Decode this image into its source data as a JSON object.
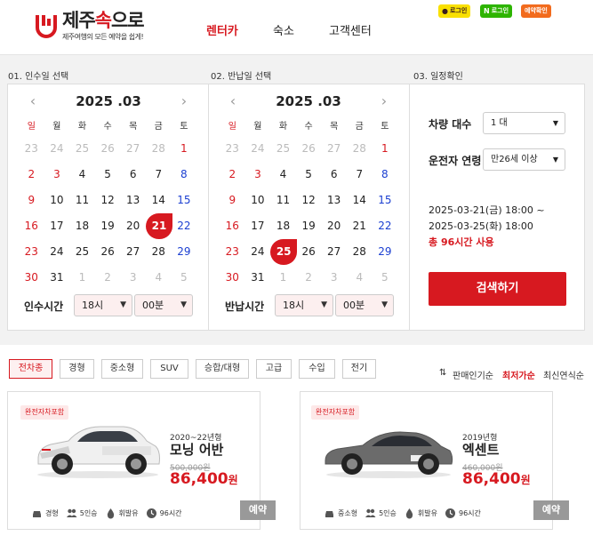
{
  "header": {
    "logo_title_a": "제주",
    "logo_title_b": "속",
    "logo_title_c": "으로",
    "logo_tagline": "제주여행의 모든 예약을 쉽게!",
    "nav": [
      "렌터카",
      "숙소",
      "고객센터"
    ],
    "kakao_login": "로그인",
    "naver_login": "로그인",
    "reserve_check": "예약확인"
  },
  "sections": {
    "pickup_label": "01. 인수일 선택",
    "return_label": "02. 반납일 선택",
    "confirm_label": "03. 일정확인"
  },
  "calendar": {
    "month_label": "2025 .03",
    "weekdays": [
      "일",
      "월",
      "화",
      "수",
      "목",
      "금",
      "토"
    ],
    "weeks": [
      [
        "23",
        "24",
        "25",
        "26",
        "27",
        "28",
        "1"
      ],
      [
        "2",
        "3",
        "4",
        "5",
        "6",
        "7",
        "8"
      ],
      [
        "9",
        "10",
        "11",
        "12",
        "13",
        "14",
        "15"
      ],
      [
        "16",
        "17",
        "18",
        "19",
        "20",
        "21",
        "22"
      ],
      [
        "23",
        "24",
        "25",
        "26",
        "27",
        "28",
        "29"
      ],
      [
        "30",
        "31",
        "1",
        "2",
        "3",
        "4",
        "5"
      ]
    ],
    "pickup_selected": "21",
    "return_selected": "25"
  },
  "pickup_time": {
    "label": "인수시간",
    "hour": "18시",
    "minute": "00분"
  },
  "return_time": {
    "label": "반납시간",
    "hour": "18시",
    "minute": "00분"
  },
  "confirm": {
    "car_count_label": "차량 대수",
    "car_count_value": "1 대",
    "driver_age_label": "운전자 연령",
    "driver_age_value": "만26세 이상",
    "range_from": "2025-03-21(금) 18:00 ~",
    "range_to": "2025-03-25(화) 18:00",
    "total_prefix": "총 ",
    "total_hours": "96시간",
    "total_suffix": " 사용",
    "search_button": "검색하기"
  },
  "filters": [
    "전차종",
    "경형",
    "중소형",
    "SUV",
    "승합/대형",
    "고급",
    "수입",
    "전기"
  ],
  "sort": [
    "판매인기순",
    "최저가순",
    "최신연식순"
  ],
  "cars": [
    {
      "badge": "완전자차포함",
      "year": "2020~22년형",
      "model": "모닝 어반",
      "original_price": "500,000원",
      "price": "86,400",
      "won": "원",
      "color": "#f0f0f0",
      "specs": [
        "경형",
        "5인승",
        "휘발유",
        "96시간"
      ],
      "reserve": "예약"
    },
    {
      "badge": "완전자차포함",
      "year": "2019년형",
      "model": "엑센트",
      "original_price": "460,000원",
      "price": "86,400",
      "won": "원",
      "color": "#6b6b6b",
      "specs": [
        "중소형",
        "5인승",
        "휘발유",
        "96시간"
      ],
      "reserve": "예약"
    }
  ],
  "colors": {
    "accent": "#d71920",
    "saturday": "#1b3fd1",
    "kakao": "#f9e000",
    "naver": "#2db400",
    "reserve": "#f26b1d"
  }
}
